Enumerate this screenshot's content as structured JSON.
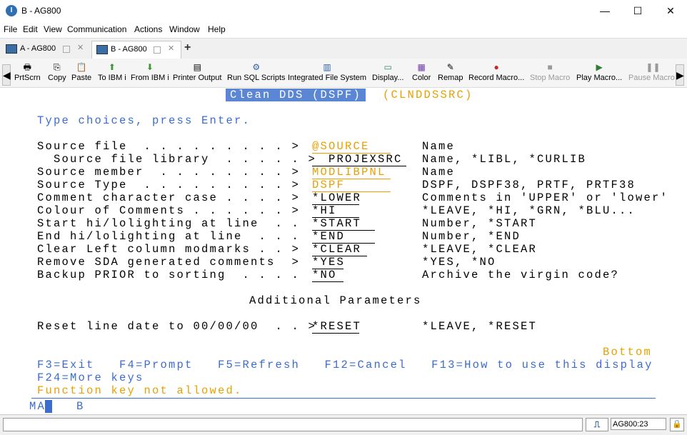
{
  "window": {
    "title": "B - AG800",
    "minimize": "—",
    "maximize": "☐",
    "close": "✕",
    "app_icon": "I"
  },
  "menu": [
    "File",
    "Edit",
    "View",
    "Communication",
    "Actions",
    "Window",
    "Help"
  ],
  "tabs": [
    {
      "label": "A - AG800",
      "close": "✕"
    },
    {
      "label": "B - AG800",
      "close": "✕"
    }
  ],
  "new_tab": "+",
  "toolbar": [
    {
      "label": "PrtScrn",
      "icon": "printer-icon",
      "glyph": "🖶"
    },
    {
      "label": "Copy",
      "icon": "copy-icon",
      "glyph": "⎘"
    },
    {
      "label": "Paste",
      "icon": "paste-icon",
      "glyph": "📋"
    },
    {
      "label": "To IBM i",
      "icon": "upload-icon",
      "glyph": "⬆"
    },
    {
      "label": "From IBM i",
      "icon": "download-icon",
      "glyph": "⬇"
    },
    {
      "label": "Printer Output",
      "icon": "printer-output-icon",
      "glyph": "▤"
    },
    {
      "label": "Run SQL Scripts",
      "icon": "sql-scripts-icon",
      "glyph": "⚙"
    },
    {
      "label": "Integrated File System",
      "icon": "file-system-icon",
      "glyph": "▥"
    },
    {
      "label": "Display...",
      "icon": "display-icon",
      "glyph": "▭"
    },
    {
      "label": "Color",
      "icon": "color-icon",
      "glyph": "▦"
    },
    {
      "label": "Remap",
      "icon": "remap-icon",
      "glyph": "✎"
    },
    {
      "label": "Record Macro...",
      "icon": "record-macro-icon",
      "glyph": "●"
    },
    {
      "label": "Stop Macro",
      "icon": "stop-macro-icon",
      "glyph": "■"
    },
    {
      "label": "Play Macro...",
      "icon": "play-macro-icon",
      "glyph": "▶"
    },
    {
      "label": "Pause Macro",
      "icon": "pause-macro-icon",
      "glyph": "❚❚"
    }
  ],
  "nav": {
    "left": "◀",
    "right": "▶"
  },
  "screen": {
    "title": "Clean DDS (DSPF)",
    "program": "(CLNDDSSRC)",
    "instruction": "Type choices, press Enter.",
    "fields": [
      {
        "label": "Source file  . . . . . . . . . >",
        "value": "@SOURCE",
        "hint": "Name"
      },
      {
        "label": "  Source file library  . . . . . >",
        "value": "  PROJEXSRC",
        "hint": "Name, *LIBL, *CURLIB"
      },
      {
        "label": "Source member  . . . . . . . . >",
        "value": "MODLIBPNL",
        "hint": "Name"
      },
      {
        "label": "Source Type  . . . . . . . . . >",
        "value": "DSPF",
        "hint": "DSPF, DSPF38, PRTF, PRTF38"
      },
      {
        "label": "Comment character case . . . . >",
        "value": "*LOWER",
        "hint": "Comments in 'UPPER' or 'lower'"
      },
      {
        "label": "Colour of Comments . . . . . . >",
        "value": "*HI",
        "hint": "*LEAVE, *HI, *GRN, *BLU..."
      },
      {
        "label": "Start hi/lolighting at line  . .",
        "value": "*START",
        "hint": "Number, *START"
      },
      {
        "label": "End hi/lolighting at line  . . .",
        "value": "*END",
        "hint": "Number, *END"
      },
      {
        "label": "Clear Left column modmarks . . >",
        "value": "*CLEAR",
        "hint": "*LEAVE, *CLEAR"
      },
      {
        "label": "Remove SDA generated comments  >",
        "value": "*YES",
        "hint": "*YES, *NO"
      },
      {
        "label": "Backup PRIOR to sorting  . . . .",
        "value": "*NO",
        "hint": "Archive the virgin code?"
      }
    ],
    "additional_title": "Additional Parameters",
    "reset_field": {
      "label": "Reset line date to 00/00/00  . . >",
      "value": "*RESET",
      "hint": "*LEAVE, *RESET"
    },
    "bottom": "Bottom",
    "fkeys_line1": "F3=Exit   F4=Prompt   F5=Refresh   F12=Cancel   F13=How to use this display",
    "fkeys_line2": "F24=More keys",
    "message": "Function key not allowed.",
    "oia_left": "MA",
    "oia_b": "B"
  },
  "statusbar": {
    "connection": "AG800:23",
    "conn_glyph": "⎍",
    "lock_glyph": "🔒"
  }
}
